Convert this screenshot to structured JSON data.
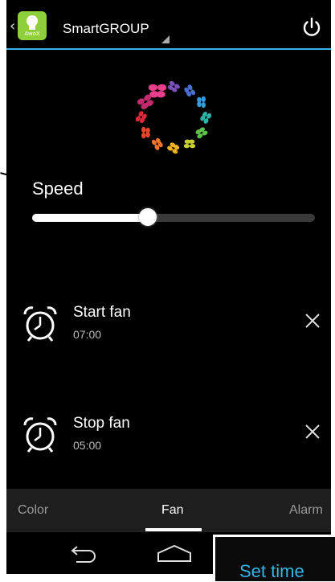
{
  "app": {
    "icon_text": "AwoX",
    "title": "SmartGROUP"
  },
  "speed": {
    "label": "Speed",
    "level_percent": 41
  },
  "alarms": [
    {
      "title": "Start fan",
      "time": "07:00"
    },
    {
      "title": "Stop fan",
      "time": "05:00"
    }
  ],
  "tabs": {
    "color": "Color",
    "fan": "Fan",
    "alarm": "Alarm",
    "selected": "Fan"
  },
  "popup": {
    "label": "Set time"
  },
  "colors": {
    "accent": "#33b5e5",
    "app_icon": "#8fcf3c"
  },
  "icons": {
    "back": "back-chevron-icon",
    "power": "power-icon",
    "alarm": "alarm-clock-icon",
    "delete": "close-icon",
    "nav_back": "nav-back-icon",
    "nav_home": "nav-home-icon"
  }
}
